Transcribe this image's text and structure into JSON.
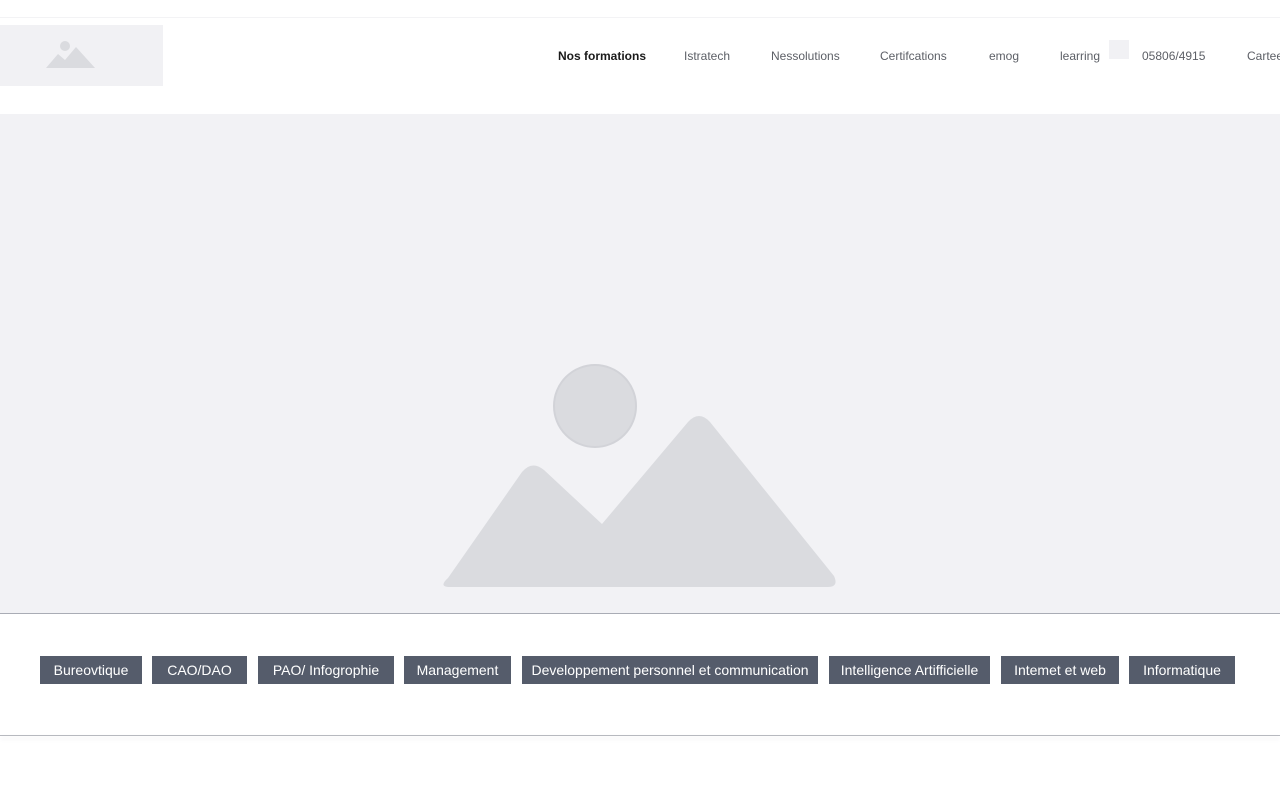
{
  "header": {
    "logo_icon": "image-placeholder-icon",
    "nav": [
      "Nos formations",
      "Istratech",
      "Nessolutions",
      "Certifcations",
      "emog",
      "learring",
      "05806/4915",
      "Cartee"
    ],
    "active_index": 0
  },
  "hero": {
    "icon": "image-placeholder-icon"
  },
  "categories": [
    "Bureovtique",
    "CAO/DAO",
    "PAO/ Infogrophie",
    "Management",
    "Developpement personnel et communication",
    "Intelligence Artifficielle",
    "Intemet et web",
    "Informatique"
  ],
  "colors": {
    "button_bg": "#555c6b",
    "placeholder_bg": "#f2f2f5",
    "placeholder_shape": "#dadbdf"
  }
}
